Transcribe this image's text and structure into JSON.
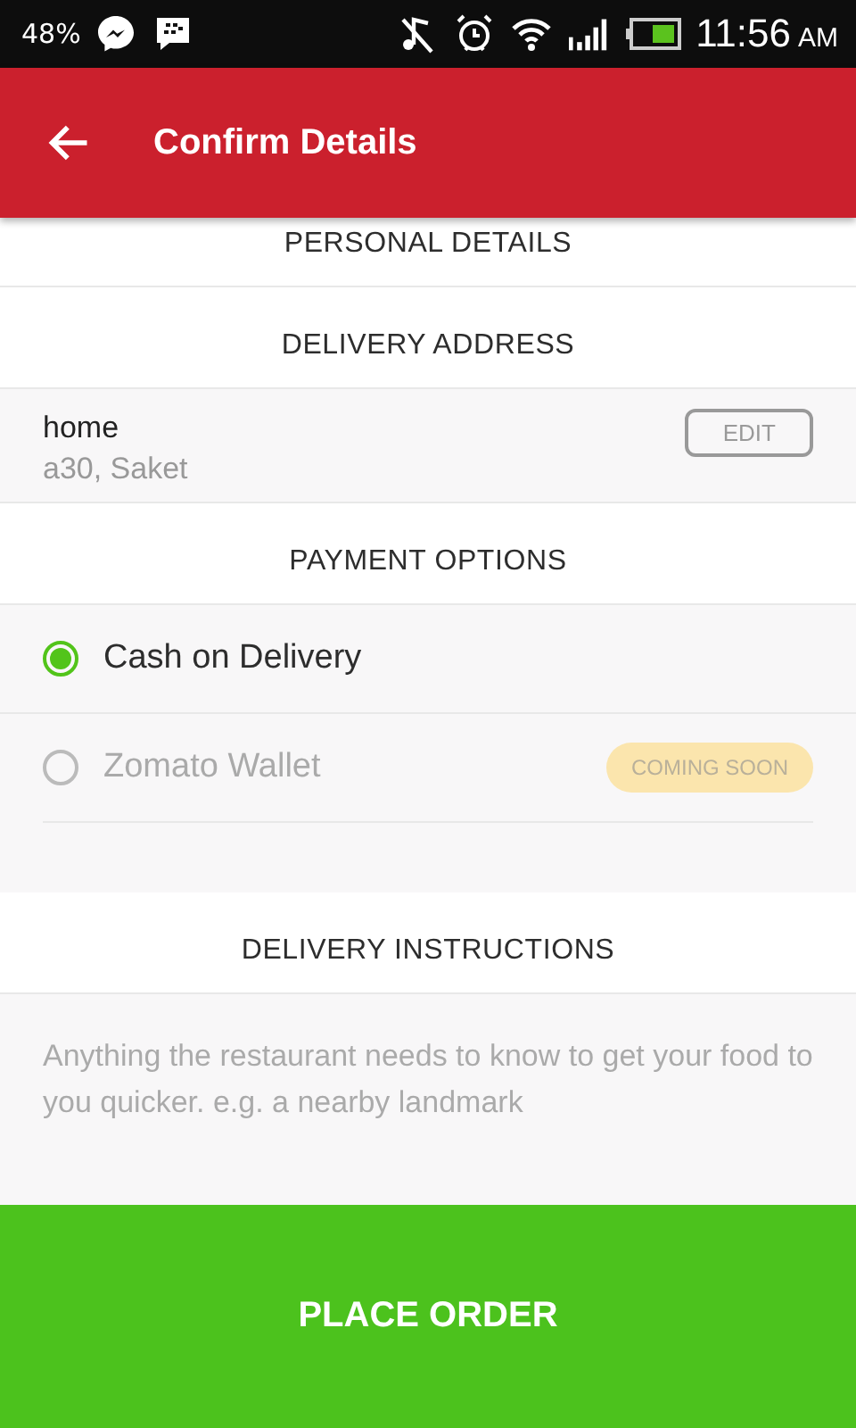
{
  "status_bar": {
    "battery_percent": "48%",
    "time": "11:56",
    "ampm": "AM"
  },
  "header": {
    "title": "Confirm Details"
  },
  "personal_details": {
    "heading": "PERSONAL DETAILS"
  },
  "delivery_address": {
    "heading": "DELIVERY ADDRESS",
    "name": "home",
    "address": "a30, Saket",
    "edit_button": "EDIT"
  },
  "payment_options": {
    "heading": "PAYMENT OPTIONS",
    "options": [
      {
        "label": "Cash on Delivery",
        "selected": true,
        "disabled": false
      },
      {
        "label": "Zomato Wallet",
        "selected": false,
        "disabled": true,
        "badge": "COMING SOON"
      }
    ]
  },
  "delivery_instructions": {
    "heading": "DELIVERY INSTRUCTIONS",
    "placeholder": "Anything the restaurant needs to know to get your food to you quicker. e.g. a nearby landmark"
  },
  "place_order_button": "PLACE ORDER"
}
